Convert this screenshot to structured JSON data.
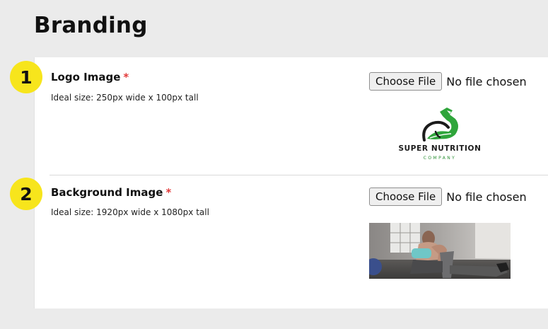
{
  "page": {
    "title": "Branding"
  },
  "fields": [
    {
      "step": "1",
      "label": "Logo Image",
      "required_marker": "*",
      "hint": "Ideal size: 250px wide x 100px tall",
      "button_label": "Choose File",
      "file_status": "No file chosen",
      "preview": {
        "brand_name": "SUPER NUTRITION",
        "brand_sub": "COMPANY",
        "icon": "flexed-arm-leaf-icon"
      }
    },
    {
      "step": "2",
      "label": "Background Image",
      "required_marker": "*",
      "hint": "Ideal size: 1920px wide x 1080px tall",
      "button_label": "Choose File",
      "file_status": "No file chosen",
      "preview": {
        "icon": "background-photo-preview"
      }
    }
  ],
  "colors": {
    "badge": "#f7e51c",
    "required": "#e23b3b",
    "logo_green": "#2fa53b"
  }
}
